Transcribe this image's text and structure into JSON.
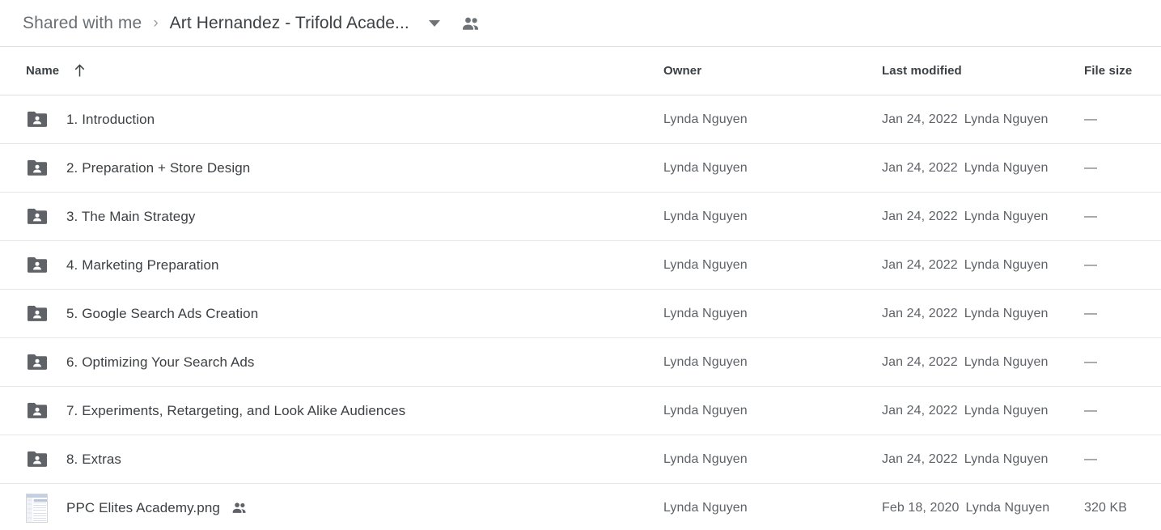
{
  "breadcrumb": {
    "root_label": "Shared with me",
    "separator": "›",
    "current_label": "Art Hernandez - Trifold Acade...",
    "caret_icon": "chevron-down-icon",
    "shared_icon": "people-shared-icon"
  },
  "table": {
    "headers": {
      "name": "Name",
      "sort_icon": "arrow-up-icon",
      "owner": "Owner",
      "last_modified": "Last modified",
      "file_size": "File size"
    },
    "rows": [
      {
        "icon": "shared-folder-icon",
        "name": "1. Introduction",
        "shared": false,
        "owner": "Lynda Nguyen",
        "modified_date": "Jan 24, 2022",
        "modified_by": "Lynda Nguyen",
        "size": "—"
      },
      {
        "icon": "shared-folder-icon",
        "name": "2. Preparation + Store Design",
        "shared": false,
        "owner": "Lynda Nguyen",
        "modified_date": "Jan 24, 2022",
        "modified_by": "Lynda Nguyen",
        "size": "—"
      },
      {
        "icon": "shared-folder-icon",
        "name": "3. The Main Strategy",
        "shared": false,
        "owner": "Lynda Nguyen",
        "modified_date": "Jan 24, 2022",
        "modified_by": "Lynda Nguyen",
        "size": "—"
      },
      {
        "icon": "shared-folder-icon",
        "name": "4. Marketing Preparation",
        "shared": false,
        "owner": "Lynda Nguyen",
        "modified_date": "Jan 24, 2022",
        "modified_by": "Lynda Nguyen",
        "size": "—"
      },
      {
        "icon": "shared-folder-icon",
        "name": "5. Google Search Ads Creation",
        "shared": false,
        "owner": "Lynda Nguyen",
        "modified_date": "Jan 24, 2022",
        "modified_by": "Lynda Nguyen",
        "size": "—"
      },
      {
        "icon": "shared-folder-icon",
        "name": "6. Optimizing Your Search Ads",
        "shared": false,
        "owner": "Lynda Nguyen",
        "modified_date": "Jan 24, 2022",
        "modified_by": "Lynda Nguyen",
        "size": "—"
      },
      {
        "icon": "shared-folder-icon",
        "name": "7. Experiments, Retargeting, and Look Alike Audiences",
        "shared": false,
        "owner": "Lynda Nguyen",
        "modified_date": "Jan 24, 2022",
        "modified_by": "Lynda Nguyen",
        "size": "—"
      },
      {
        "icon": "shared-folder-icon",
        "name": "8. Extras",
        "shared": false,
        "owner": "Lynda Nguyen",
        "modified_date": "Jan 24, 2022",
        "modified_by": "Lynda Nguyen",
        "size": "—"
      },
      {
        "icon": "image-thumbnail",
        "name": "PPC Elites Academy.png",
        "shared": true,
        "owner": "Lynda Nguyen",
        "modified_date": "Feb 18, 2020",
        "modified_by": "Lynda Nguyen",
        "size": "320 KB"
      }
    ]
  },
  "colors": {
    "folder_icon": "#5f6368",
    "text_primary": "#3c4043",
    "text_secondary": "#5f6368",
    "divider": "#e6e6e6",
    "background": "#ffffff"
  }
}
